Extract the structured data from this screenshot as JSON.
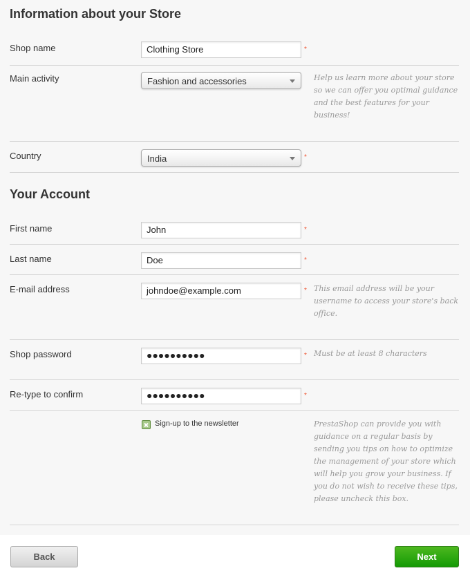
{
  "store_section": {
    "title": "Information about your Store",
    "shop_name": {
      "label": "Shop name",
      "value": "Clothing Store",
      "required": "*"
    },
    "main_activity": {
      "label": "Main activity",
      "selected": "Fashion and accessories",
      "hint": "Help us learn more about your store so we can offer you optimal guidance and the best features for your business!"
    },
    "country": {
      "label": "Country",
      "selected": "India",
      "required": "*"
    }
  },
  "account_section": {
    "title": "Your Account",
    "first_name": {
      "label": "First name",
      "value": "John",
      "required": "*"
    },
    "last_name": {
      "label": "Last name",
      "value": "Doe",
      "required": "*"
    },
    "email": {
      "label": "E-mail address",
      "value": "johndoe@example.com",
      "required": "*",
      "hint": "This email address will be your username to access your store's back office."
    },
    "password": {
      "label": "Shop password",
      "value": "●●●●●●●●●●",
      "required": "*",
      "hint": "Must be at least 8 characters"
    },
    "confirm": {
      "label": "Re-type to confirm",
      "value": "●●●●●●●●●●",
      "required": "*"
    },
    "newsletter": {
      "label": "Sign-up to the newsletter",
      "checked": true,
      "hint": "PrestaShop can provide you with guidance on a regular basis by sending you tips on how to optimize the management of your store which will help you grow your business. If you do not wish to receive these tips, please uncheck this box."
    }
  },
  "buttons": {
    "back": "Back",
    "next": "Next"
  },
  "colors": {
    "next_button": "#1fa00a",
    "required": "#ee5533",
    "hint": "#999999"
  }
}
